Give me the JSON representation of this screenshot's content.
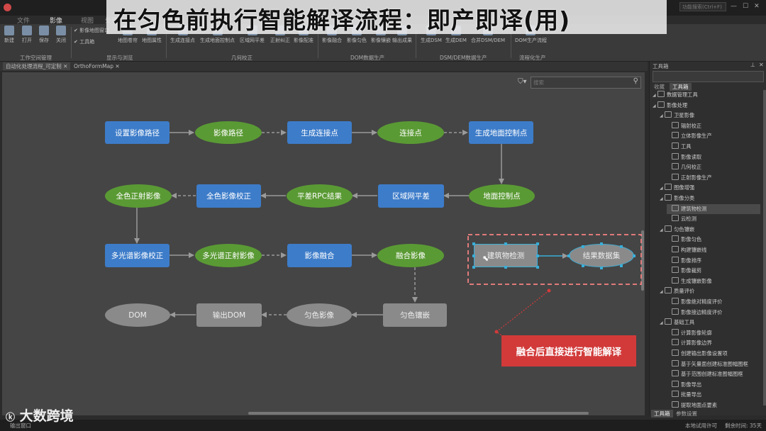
{
  "slide_title": "在匀色前执行智能解译流程：即产即译(用)",
  "ribbon": {
    "tabs": [
      "文件",
      "影像",
      "视图",
      "处理"
    ],
    "buttons": [
      "新建",
      "打开",
      "保存",
      "关闭",
      "影像地图窗口",
      "工具箱",
      "地图卷帘",
      "地图属性",
      "生成连接点",
      "生成地面控制点",
      "区域网平差",
      "正射纠正",
      "影像配准",
      "影像融合",
      "影像匀色",
      "影像镶嵌",
      "输出成果",
      "生成DSM",
      "生成DEM",
      "合并DSM/DEM",
      "DOM生产流程"
    ],
    "groups": [
      "工作空间管理",
      "显示与浏览",
      "几何校正",
      "DOM数据生产",
      "DSM/DEM数据生产",
      "流程化生产"
    ],
    "search_placeholder": "功能搜索(Ctrl+F)"
  },
  "doc_tabs": [
    "自动化处理流程_可定制",
    "OrthoFormMap"
  ],
  "canvas_search_placeholder": "搜索",
  "nodes": {
    "n1": "设置影像路径",
    "n2": "影像路径",
    "n3": "生成连接点",
    "n4": "连接点",
    "n5": "生成地面控制点",
    "n6": "全色正射影像",
    "n7": "全色影像校正",
    "n8": "平差RPC结果",
    "n9": "区域网平差",
    "n10": "地面控制点",
    "n11": "多光谱影像校正",
    "n12": "多光谱正射影像",
    "n13": "影像融合",
    "n14": "融合影像",
    "n15": "建筑物检测",
    "n16": "结果数据集",
    "n17": "DOM",
    "n18": "输出DOM",
    "n19": "匀色影像",
    "n20": "匀色镶嵌"
  },
  "callout": "融合后直接进行智能解译",
  "panel": {
    "title": "工具箱",
    "tabs": [
      "收藏",
      "工具箱"
    ],
    "tree": [
      {
        "label": "数据管理工具",
        "level": 1
      },
      {
        "label": "影像处理",
        "level": 1
      },
      {
        "label": "卫星影像",
        "level": 2
      },
      {
        "label": "辐射校正",
        "level": 3
      },
      {
        "label": "立体影像生产",
        "level": 3
      },
      {
        "label": "工具",
        "level": 3
      },
      {
        "label": "影像读取",
        "level": 3
      },
      {
        "label": "几何校正",
        "level": 3
      },
      {
        "label": "正射影像生产",
        "level": 3
      },
      {
        "label": "图像增强",
        "level": 2
      },
      {
        "label": "影像分类",
        "level": 2
      },
      {
        "label": "建筑物检测",
        "level": 3
      },
      {
        "label": "云检测",
        "level": 3
      },
      {
        "label": "匀色镶嵌",
        "level": 2
      },
      {
        "label": "影像匀色",
        "level": 3
      },
      {
        "label": "构建镶嵌线",
        "level": 3
      },
      {
        "label": "影像排序",
        "level": 3
      },
      {
        "label": "影像裁剪",
        "level": 3
      },
      {
        "label": "生成镶嵌影像",
        "level": 3
      },
      {
        "label": "质量评价",
        "level": 2
      },
      {
        "label": "影像绝对精度评价",
        "level": 3
      },
      {
        "label": "影像接边精度评价",
        "level": 3
      },
      {
        "label": "基础工具",
        "level": 2
      },
      {
        "label": "计算影像轮廓",
        "level": 3
      },
      {
        "label": "计算影像边界",
        "level": 3
      },
      {
        "label": "创建输出影像设置项",
        "level": 3
      },
      {
        "label": "基于矢量面创建标准图幅图框",
        "level": 3
      },
      {
        "label": "基于范围创建标准图幅图框",
        "level": 3
      },
      {
        "label": "影像导出",
        "level": 3
      },
      {
        "label": "批量导出",
        "level": 3
      },
      {
        "label": "提取地面点要素",
        "level": 3
      }
    ],
    "bottom_tabs": [
      "工具箱",
      "参数设置"
    ]
  },
  "status": {
    "left": "输出窗口",
    "license": "本地试用许可",
    "remaining": "剩余时间: 35天"
  },
  "watermark": "大数跨境"
}
